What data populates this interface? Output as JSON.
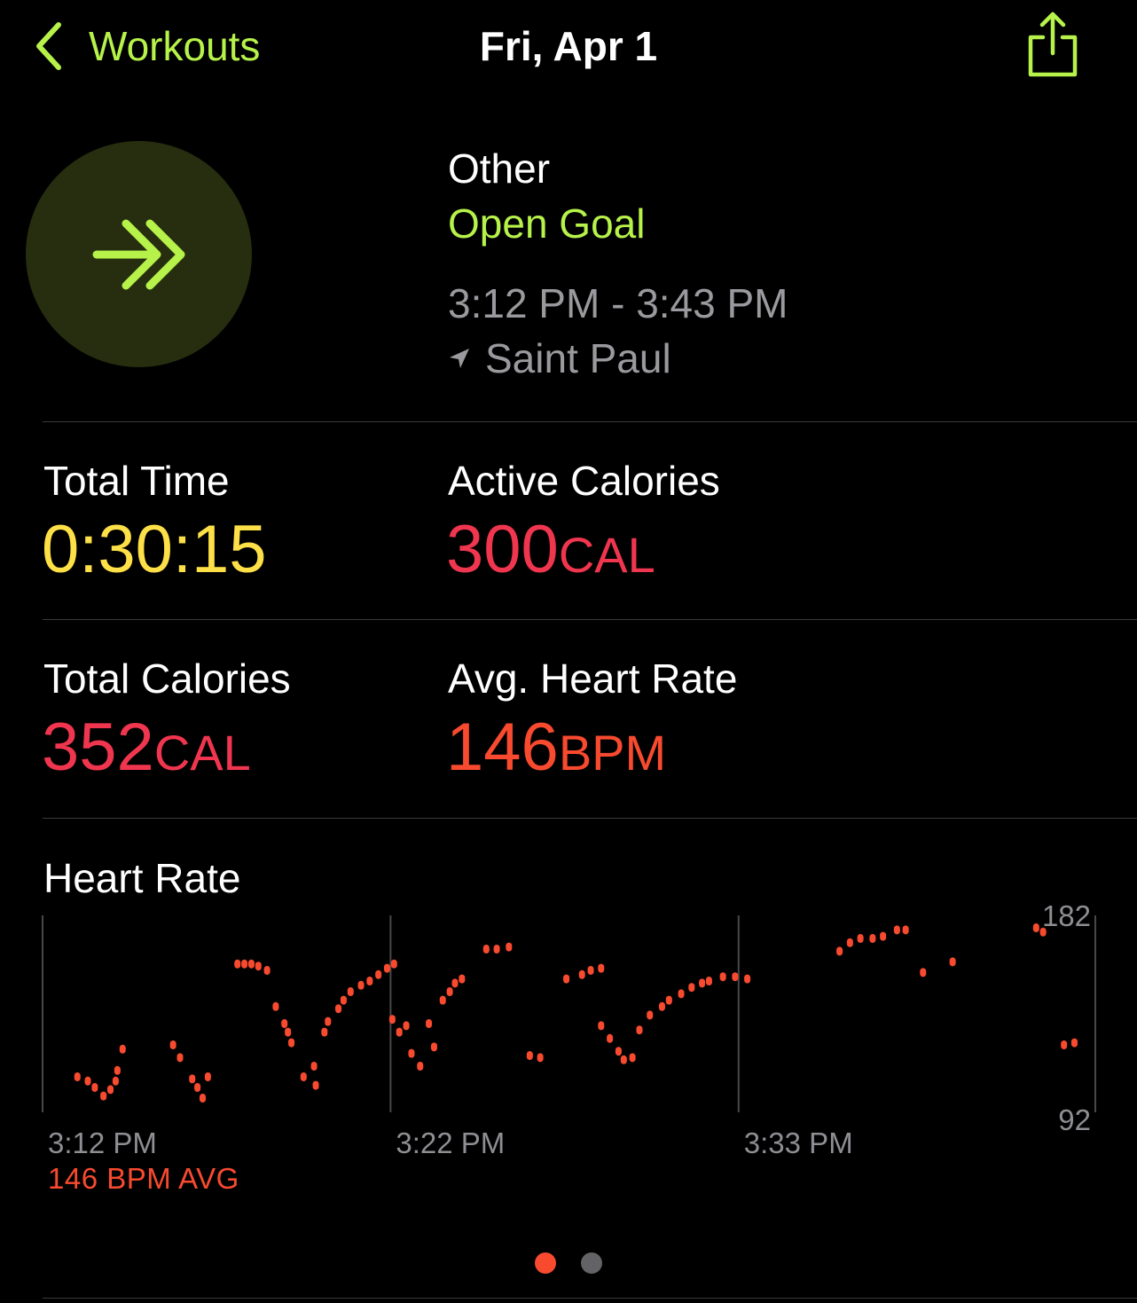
{
  "nav": {
    "back_label": "Workouts",
    "title": "Fri, Apr 1"
  },
  "workout": {
    "type": "Other",
    "goal": "Open Goal",
    "time_range": "3:12 PM - 3:43 PM",
    "location": "Saint Paul"
  },
  "metrics": {
    "total_time": {
      "label": "Total Time",
      "value": "0:30:15"
    },
    "active_calories": {
      "label": "Active Calories",
      "value": "300",
      "unit": "CAL"
    },
    "total_calories": {
      "label": "Total Calories",
      "value": "352",
      "unit": "CAL"
    },
    "avg_heart_rate": {
      "label": "Avg. Heart Rate",
      "value": "146",
      "unit": "BPM"
    }
  },
  "chart_title": "Heart Rate",
  "avg_label": "146 BPM AVG",
  "colors": {
    "accent_green": "#b6f24a",
    "time_yellow": "#fde047",
    "calories_pink": "#f0364f",
    "heart_orange": "#f84a2f"
  },
  "icons": {
    "back": "chevron-left-icon",
    "share": "share-icon",
    "activity": "double-chevron-right-icon",
    "location": "location-arrow-icon"
  },
  "page_indicator": {
    "count": 2,
    "active": 0
  },
  "chart_data": {
    "type": "scatter",
    "title": "Heart Rate",
    "x_ticks": [
      "3:12 PM",
      "3:22 PM",
      "3:33 PM"
    ],
    "x_range_minutes": [
      0,
      30.25
    ],
    "y_ticks": [
      "182",
      "92"
    ],
    "ylim": [
      92,
      182
    ],
    "series": [
      {
        "values": [
          [
            1.0,
            107
          ],
          [
            1.3,
            105
          ],
          [
            1.5,
            102
          ],
          [
            1.75,
            98
          ],
          [
            1.95,
            101
          ],
          [
            2.1,
            105
          ],
          [
            2.15,
            110
          ],
          [
            2.3,
            120
          ],
          [
            3.75,
            122
          ],
          [
            3.95,
            116
          ],
          [
            4.3,
            106
          ],
          [
            4.45,
            102
          ],
          [
            4.6,
            97
          ],
          [
            4.75,
            107
          ],
          [
            5.6,
            160
          ],
          [
            5.8,
            160
          ],
          [
            6.0,
            160
          ],
          [
            6.2,
            159
          ],
          [
            6.45,
            157
          ],
          [
            6.7,
            140
          ],
          [
            6.95,
            132
          ],
          [
            7.05,
            128
          ],
          [
            7.15,
            123
          ],
          [
            7.5,
            107
          ],
          [
            7.8,
            112
          ],
          [
            7.85,
            103
          ],
          [
            8.1,
            128
          ],
          [
            8.2,
            133
          ],
          [
            8.5,
            139
          ],
          [
            8.65,
            143
          ],
          [
            8.85,
            147
          ],
          [
            9.15,
            150
          ],
          [
            9.4,
            152
          ],
          [
            9.65,
            155
          ],
          [
            9.9,
            158
          ],
          [
            10.1,
            160
          ],
          [
            10.05,
            134
          ],
          [
            10.25,
            128
          ],
          [
            10.45,
            131
          ],
          [
            10.6,
            118
          ],
          [
            10.85,
            112
          ],
          [
            11.1,
            132
          ],
          [
            11.25,
            121
          ],
          [
            11.5,
            143
          ],
          [
            11.7,
            147
          ],
          [
            11.85,
            151
          ],
          [
            12.05,
            153
          ],
          [
            12.75,
            167
          ],
          [
            13.05,
            167
          ],
          [
            13.4,
            168
          ],
          [
            14.0,
            117
          ],
          [
            14.3,
            116
          ],
          [
            15.05,
            153
          ],
          [
            15.5,
            155
          ],
          [
            15.75,
            157
          ],
          [
            16.05,
            158
          ],
          [
            16.05,
            131
          ],
          [
            16.3,
            125
          ],
          [
            16.55,
            119
          ],
          [
            16.7,
            115
          ],
          [
            16.95,
            116
          ],
          [
            17.15,
            129
          ],
          [
            17.45,
            136
          ],
          [
            17.8,
            140
          ],
          [
            18.0,
            143
          ],
          [
            18.35,
            146
          ],
          [
            18.65,
            149
          ],
          [
            18.95,
            151
          ],
          [
            19.15,
            152
          ],
          [
            19.55,
            154
          ],
          [
            19.9,
            154
          ],
          [
            20.25,
            153
          ],
          [
            22.9,
            166
          ],
          [
            23.2,
            170
          ],
          [
            23.5,
            172
          ],
          [
            23.85,
            172
          ],
          [
            24.15,
            173
          ],
          [
            24.55,
            176
          ],
          [
            24.8,
            176
          ],
          [
            25.3,
            156
          ],
          [
            26.15,
            161
          ],
          [
            28.55,
            177
          ],
          [
            28.75,
            175
          ],
          [
            29.35,
            122
          ],
          [
            29.65,
            123
          ]
        ]
      }
    ]
  }
}
